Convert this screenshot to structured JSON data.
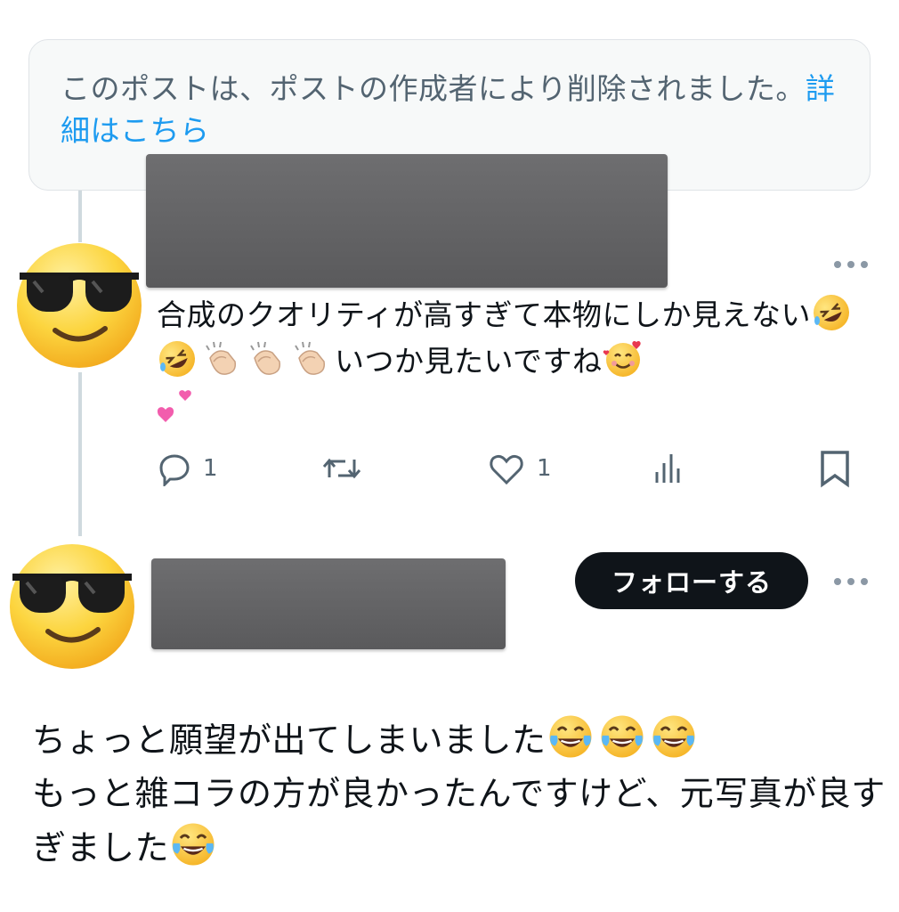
{
  "deleted_notice": {
    "text": "このポストは、ポストの作成者により削除されました。",
    "link": "詳細はこちら"
  },
  "reply": {
    "text_part1": "合成のクオリティが高すぎて本物にしか見えない",
    "text_part2": "いつか見たいですね",
    "avatar_icon": "sunglasses-face-emoji",
    "actions": {
      "reply_count": "1",
      "repost_count": "",
      "like_count": "1"
    }
  },
  "post": {
    "avatar_icon": "sunglasses-face-emoji",
    "follow_label": "フォローする",
    "line1": "ちょっと願望が出てしまいました",
    "line2": "もっと雑コラの方が良かったんですけど、元写真が良すぎました"
  },
  "colors": {
    "link": "#1d9bf0",
    "muted": "#536471",
    "text": "#0f1419",
    "thread_line": "#cfd9de"
  }
}
